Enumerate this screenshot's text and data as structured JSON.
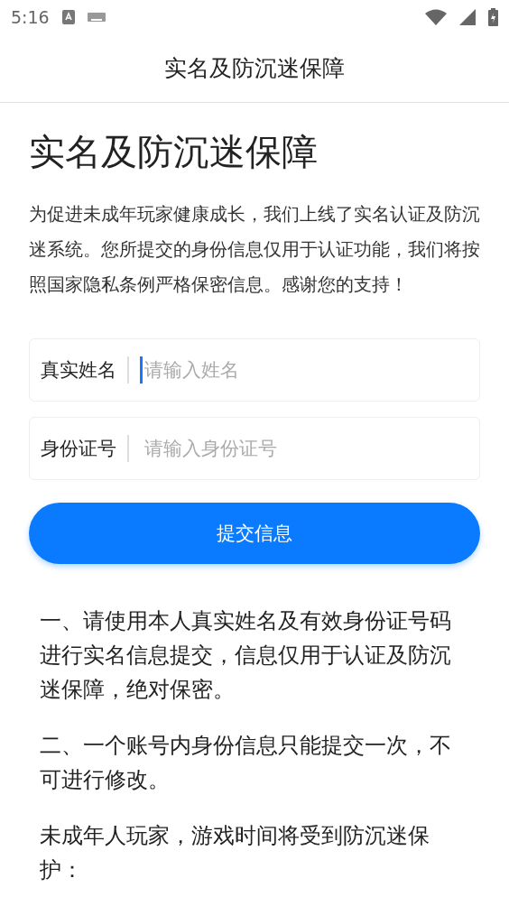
{
  "status_bar": {
    "time": "5:16"
  },
  "header": {
    "title": "实名及防沉迷保障"
  },
  "heading": "实名及防沉迷保障",
  "intro": "为促进未成年玩家健康成长，我们上线了实名认证及防沉迷系统。您所提交的身份信息仅用于认证功能，我们将按照国家隐私条例严格保密信息。感谢您的支持！",
  "fields": [
    {
      "label": "真实姓名",
      "placeholder": "请输入姓名",
      "focused": true
    },
    {
      "label": "身份证号",
      "placeholder": "请输入身份证号",
      "focused": false
    }
  ],
  "submit_button": "提交信息",
  "notes": [
    "一、请使用本人真实姓名及有效身份证号码进行实名信息提交，信息仅用于认证及防沉迷保障，绝对保密。",
    "二、一个账号内身份信息只能提交一次，不可进行修改。",
    "未成年人玩家，游戏时间将受到防沉迷保护："
  ]
}
